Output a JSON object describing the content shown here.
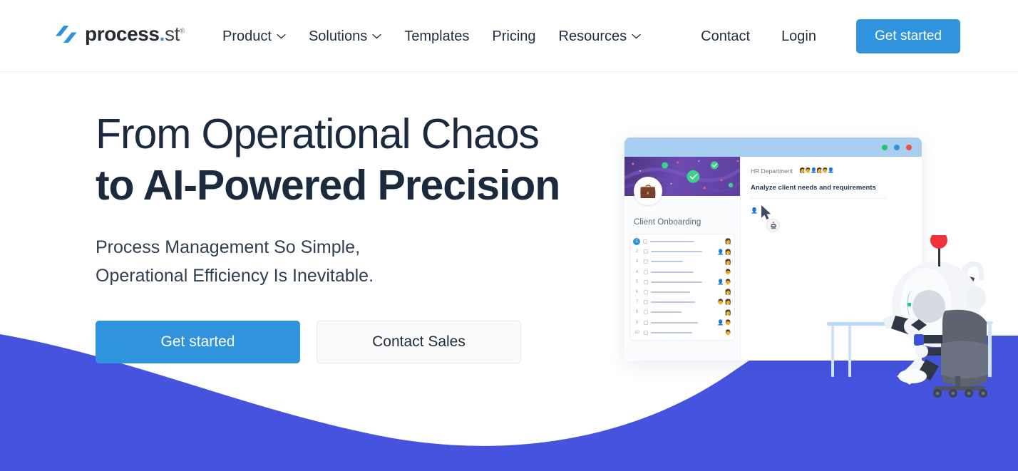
{
  "brand": {
    "name": "process",
    "dot": ".",
    "suffix": "st",
    "registered": "®",
    "logo_icon": "process-st-logo-icon",
    "accent_blue": "#3093de",
    "wave_blue": "#4553de",
    "headline_color": "#1b2a3d"
  },
  "header": {
    "nav": [
      {
        "label": "Product",
        "has_dropdown": true,
        "icon": "chevron-down-icon"
      },
      {
        "label": "Solutions",
        "has_dropdown": true,
        "icon": "chevron-down-icon"
      },
      {
        "label": "Templates",
        "has_dropdown": false
      },
      {
        "label": "Pricing",
        "has_dropdown": false
      },
      {
        "label": "Resources",
        "has_dropdown": true,
        "icon": "chevron-down-icon"
      }
    ],
    "contact_label": "Contact",
    "login_label": "Login",
    "cta_label": "Get started"
  },
  "hero": {
    "headline_line1": "From Operational Chaos",
    "headline_line2": "to AI-Powered Precision",
    "subhead_line1": "Process Management So Simple,",
    "subhead_line2": "Operational Efficiency Is Inevitable.",
    "primary_cta": "Get started",
    "secondary_cta": "Contact Sales"
  },
  "illustration": {
    "window_dots": [
      "#27c46b",
      "#2e93df",
      "#f2503f"
    ],
    "sidebar": {
      "avatar_icon": "briefcase-avatar-icon",
      "workflow_title": "Client Onboarding",
      "checklist": [
        {
          "num": "1",
          "bar": 62,
          "avatars": [
            "👩"
          ],
          "active": true
        },
        {
          "num": "2",
          "bar": 72,
          "avatars": [
            "👤",
            "👩"
          ]
        },
        {
          "num": "3",
          "bar": 45,
          "avatars": [
            "👩"
          ]
        },
        {
          "num": "4",
          "bar": 60,
          "avatars": [
            "👨"
          ]
        },
        {
          "num": "5",
          "bar": 72,
          "avatars": [
            "👤",
            "👨"
          ]
        },
        {
          "num": "6",
          "bar": 55,
          "avatars": [
            "👩"
          ]
        },
        {
          "num": "7",
          "bar": 62,
          "avatars": [
            "👨",
            "👩"
          ]
        },
        {
          "num": "8",
          "bar": 43,
          "avatars": [
            "👩"
          ]
        },
        {
          "num": "9",
          "bar": 66,
          "avatars": [
            "👤",
            "👨"
          ]
        },
        {
          "num": "10",
          "bar": 58,
          "avatars": [
            "👨"
          ]
        }
      ]
    },
    "main": {
      "group_label": "HR Department",
      "group_avatars": [
        "👩",
        "👨",
        "👤",
        "👩",
        "👨",
        "👤"
      ],
      "task_title": "Analyze client needs and requirements",
      "cursor_icon": "mouse-cursor-icon",
      "assign_icon": "assignee-person-icon",
      "bot_icon": "ai-bot-icon"
    },
    "robot_scene": {
      "icon": "robot-at-desk-icon",
      "antenna_color": "#f0323c",
      "chair_color": "#5d6470",
      "desk_color": "#bcd9f4"
    }
  }
}
